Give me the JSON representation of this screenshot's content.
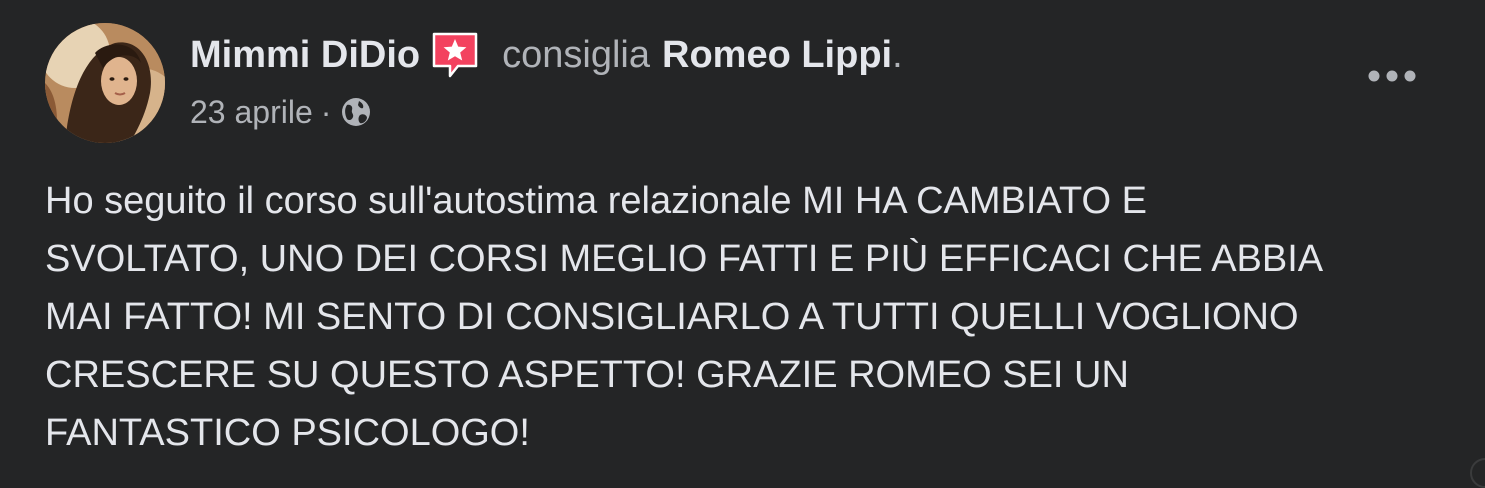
{
  "post": {
    "author": "Mimmi DiDio",
    "verb": "consiglia",
    "target": "Romeo Lippi",
    "period": ".",
    "date": "23 aprile",
    "separator": "·",
    "privacy_icon": "globe-icon",
    "recommend_icon": "recommendation-star-icon",
    "more_icon": "more-options-icon",
    "body_lines": [
      "Ho seguito il corso sull'autostima relazionale MI HA CAMBIATO E",
      "SVOLTATO, UNO DEI CORSI MEGLIO FATTI E PIÙ EFFICACI CHE ABBIA",
      "MAI FATTO! MI SENTO DI CONSIGLIARLO A TUTTI QUELLI VOGLIONO",
      "CRESCERE SU QUESTO ASPETTO! GRAZIE ROMEO SEI UN",
      "FANTASTICO PSICOLOGO!"
    ]
  },
  "colors": {
    "background": "#242526",
    "primary_text": "#e4e6eb",
    "secondary_text": "#b0b3b8",
    "recommend_accent": "#f3425f"
  }
}
